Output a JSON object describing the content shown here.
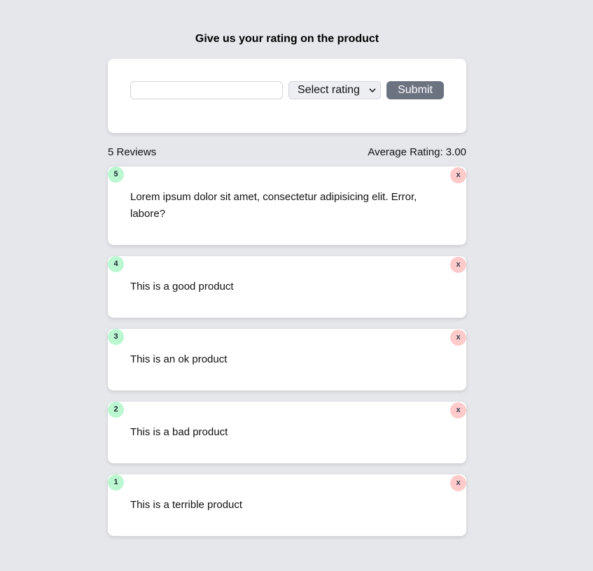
{
  "page": {
    "title": "Give us your rating on the product"
  },
  "form": {
    "review_input_value": "",
    "select_value": "Select rating",
    "submit_label": "Submit"
  },
  "stats": {
    "count_text": "5 Reviews",
    "average_text": "Average Rating: 3.00"
  },
  "reviews": [
    {
      "rating": "5",
      "text": "Lorem ipsum dolor sit amet, consectetur adipisicing elit. Error, labore?",
      "delete_label": "x"
    },
    {
      "rating": "4",
      "text": "This is a good product",
      "delete_label": "x"
    },
    {
      "rating": "3",
      "text": "This is an ok product",
      "delete_label": "x"
    },
    {
      "rating": "2",
      "text": "This is a bad product",
      "delete_label": "x"
    },
    {
      "rating": "1",
      "text": "This is a terrible product",
      "delete_label": "x"
    }
  ],
  "colors": {
    "background": "#e5e7eb",
    "rating_badge": "#bbf7d0",
    "delete_badge": "#fecaca",
    "submit_button": "#6b7280"
  }
}
